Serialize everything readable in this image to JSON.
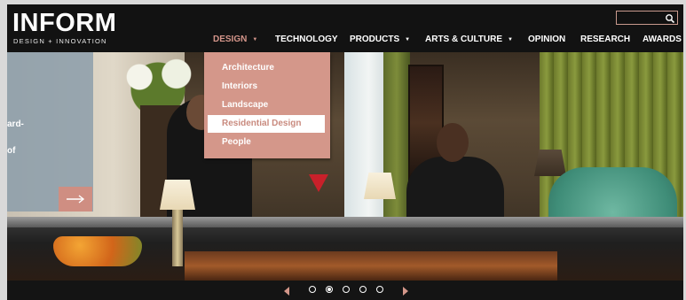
{
  "logo": {
    "main": "INFORM",
    "sub": "DESIGN + INNOVATION"
  },
  "search": {
    "value": ""
  },
  "nav": [
    {
      "label": "DESIGN",
      "dropdown": true,
      "active": true
    },
    {
      "label": "TECHNOLOGY",
      "dropdown": false
    },
    {
      "label": "PRODUCTS",
      "dropdown": true
    },
    {
      "label": "ARTS & CULTURE",
      "dropdown": true
    },
    {
      "label": "OPINION",
      "dropdown": false
    },
    {
      "label": "RESEARCH",
      "dropdown": false
    },
    {
      "label": "AWARDS",
      "dropdown": false
    }
  ],
  "design_menu": [
    {
      "label": "Architecture"
    },
    {
      "label": "Interiors"
    },
    {
      "label": "Landscape"
    },
    {
      "label": "Residential Design",
      "highlighted": true
    },
    {
      "label": "People"
    }
  ],
  "hero": {
    "overlay_fragments": [
      "ard-",
      "of"
    ]
  },
  "carousel": {
    "slide_count": 5,
    "active_index": 1
  },
  "colors": {
    "accent": "#d4978a",
    "header_bg": "#121212"
  },
  "icons": {
    "search": "search-icon",
    "next": "arrow-right-icon",
    "prev": "chevron-left-icon",
    "carousel_next": "chevron-right-icon",
    "caret": "caret-down-icon"
  }
}
